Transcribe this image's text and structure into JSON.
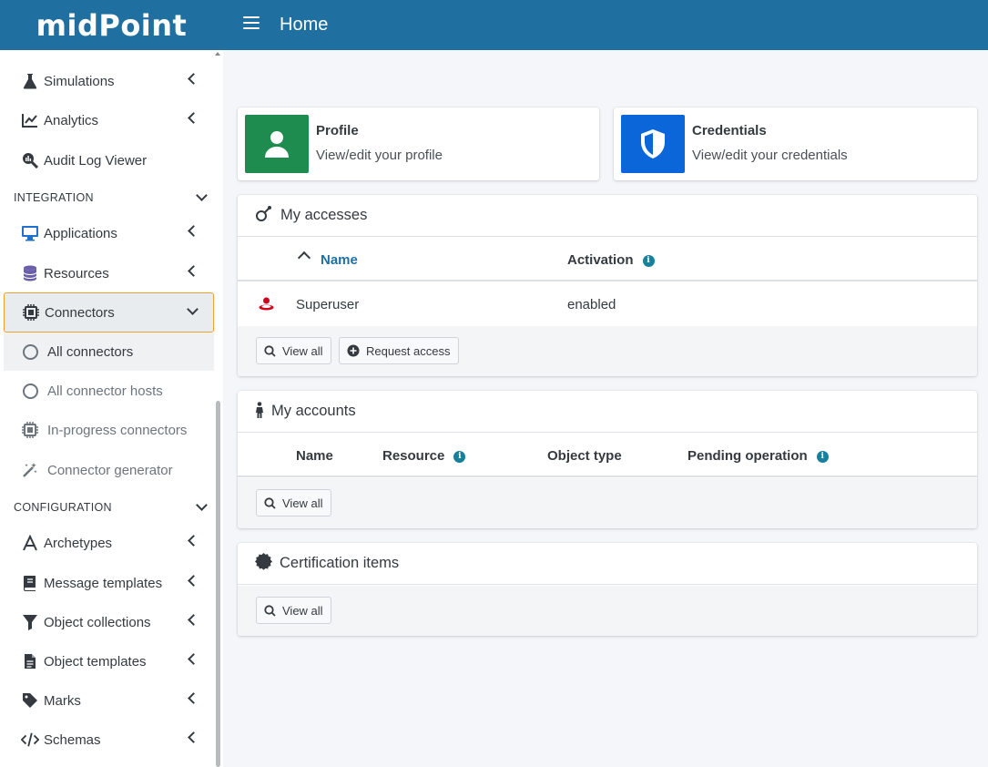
{
  "header": {
    "brand": "midPoint",
    "title": "Home"
  },
  "sidebar": {
    "items_top": [
      {
        "label": "Simulations"
      },
      {
        "label": "Analytics"
      },
      {
        "label": "Audit Log Viewer"
      }
    ],
    "integration_label": "INTEGRATION",
    "integration_items": [
      {
        "label": "Applications"
      },
      {
        "label": "Resources"
      },
      {
        "label": "Connectors"
      }
    ],
    "connector_subitems": [
      {
        "label": "All connectors"
      },
      {
        "label": "All connector hosts"
      },
      {
        "label": "In-progress connectors"
      },
      {
        "label": "Connector generator"
      }
    ],
    "configuration_label": "CONFIGURATION",
    "configuration_items": [
      {
        "label": "Archetypes"
      },
      {
        "label": "Message templates"
      },
      {
        "label": "Object collections"
      },
      {
        "label": "Object templates"
      },
      {
        "label": "Marks"
      },
      {
        "label": "Schemas"
      }
    ]
  },
  "tiles": {
    "profile": {
      "title": "Profile",
      "subtitle": "View/edit your profile",
      "color": "#1e8c4e"
    },
    "credentials": {
      "title": "Credentials",
      "subtitle": "View/edit your credentials",
      "color": "#0a66d9"
    }
  },
  "my_accesses": {
    "title": "My accesses",
    "columns": {
      "name": "Name",
      "activation": "Activation"
    },
    "rows": [
      {
        "name": "Superuser",
        "activation": "enabled"
      }
    ],
    "buttons": {
      "view_all": "View all",
      "request_access": "Request access"
    }
  },
  "my_accounts": {
    "title": "My accounts",
    "columns": {
      "name": "Name",
      "resource": "Resource",
      "object_type": "Object type",
      "pending": "Pending operation"
    },
    "buttons": {
      "view_all": "View all"
    }
  },
  "certification": {
    "title": "Certification items",
    "buttons": {
      "view_all": "View all"
    }
  }
}
